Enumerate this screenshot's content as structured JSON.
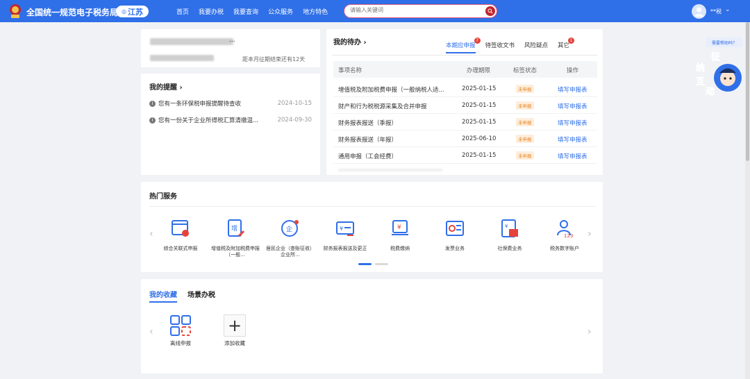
{
  "header": {
    "site_title": "全国统一规范电子税务局",
    "region": "江苏",
    "nav": [
      "首页",
      "我要办税",
      "我要查询",
      "公众服务",
      "地方特色"
    ],
    "search_placeholder": "请输入关键词",
    "user_name": "**税"
  },
  "account": {
    "deadline_text": "距本月征期结束还有12天"
  },
  "reminders": {
    "title": "我的提醒 ›",
    "items": [
      {
        "text": "您有一条环保税申报提醒待查收",
        "date": "2024-10-15"
      },
      {
        "text": "您有一份关于企业所得税汇算清缴温...",
        "date": "2024-09-30"
      }
    ]
  },
  "todo": {
    "title": "我的待办 ›",
    "tabs": [
      {
        "label": "本期应申报",
        "badge": "7"
      },
      {
        "label": "待签收文书",
        "badge": ""
      },
      {
        "label": "风险疑点",
        "badge": ""
      },
      {
        "label": "其它",
        "badge": "1"
      }
    ],
    "columns": [
      "事项名称",
      "办理期限",
      "标签状态",
      "操作"
    ],
    "rows": [
      {
        "name": "增值税及附加税费申报（一般纳税人适...",
        "date": "2025-01-15",
        "status": "未申报",
        "op": "填写申报表"
      },
      {
        "name": "财产和行为税税源采集及合并申报",
        "date": "2025-01-15",
        "status": "未申报",
        "op": "填写申报表"
      },
      {
        "name": "财务报表报送（季报）",
        "date": "2025-01-15",
        "status": "未申报",
        "op": "填写申报表"
      },
      {
        "name": "财务报表报送（年报）",
        "date": "2025-06-10",
        "status": "未申报",
        "op": "填写申报表"
      },
      {
        "name": "通用申报（工会经费）",
        "date": "2025-01-15",
        "status": "未申报",
        "op": "填写申报表"
      }
    ]
  },
  "hot_services": {
    "title": "热门服务",
    "items": [
      {
        "label": "综合关联式申报",
        "icon": "combined-declaration-icon"
      },
      {
        "label": "增值税及附加税费申报（一般...",
        "icon": "vat-declaration-icon"
      },
      {
        "label": "居民企业（查账征收）企业所...",
        "icon": "enterprise-income-tax-icon"
      },
      {
        "label": "财务报表报送及更正",
        "icon": "financial-report-icon"
      },
      {
        "label": "税费缴纳",
        "icon": "tax-payment-icon"
      },
      {
        "label": "发票业务",
        "icon": "invoice-icon"
      },
      {
        "label": "社保费业务",
        "icon": "social-security-icon"
      },
      {
        "label": "税务数字账户",
        "icon": "digital-account-icon"
      }
    ]
  },
  "favorites": {
    "tabs": [
      "我的收藏",
      "场景办税"
    ],
    "items": [
      {
        "label": "离线申报",
        "icon": "offline-declaration-icon"
      },
      {
        "label": "添加收藏",
        "icon": "plus-icon"
      }
    ]
  },
  "side": {
    "help_label": "需要帮助吗？",
    "mascot_text": [
      "征",
      "纳",
      "互",
      "动"
    ]
  },
  "colors": {
    "primary": "#2f6fe8",
    "status_bg": "#fdeedd",
    "status_fg": "#e8892b",
    "badge": "#e5433a"
  }
}
